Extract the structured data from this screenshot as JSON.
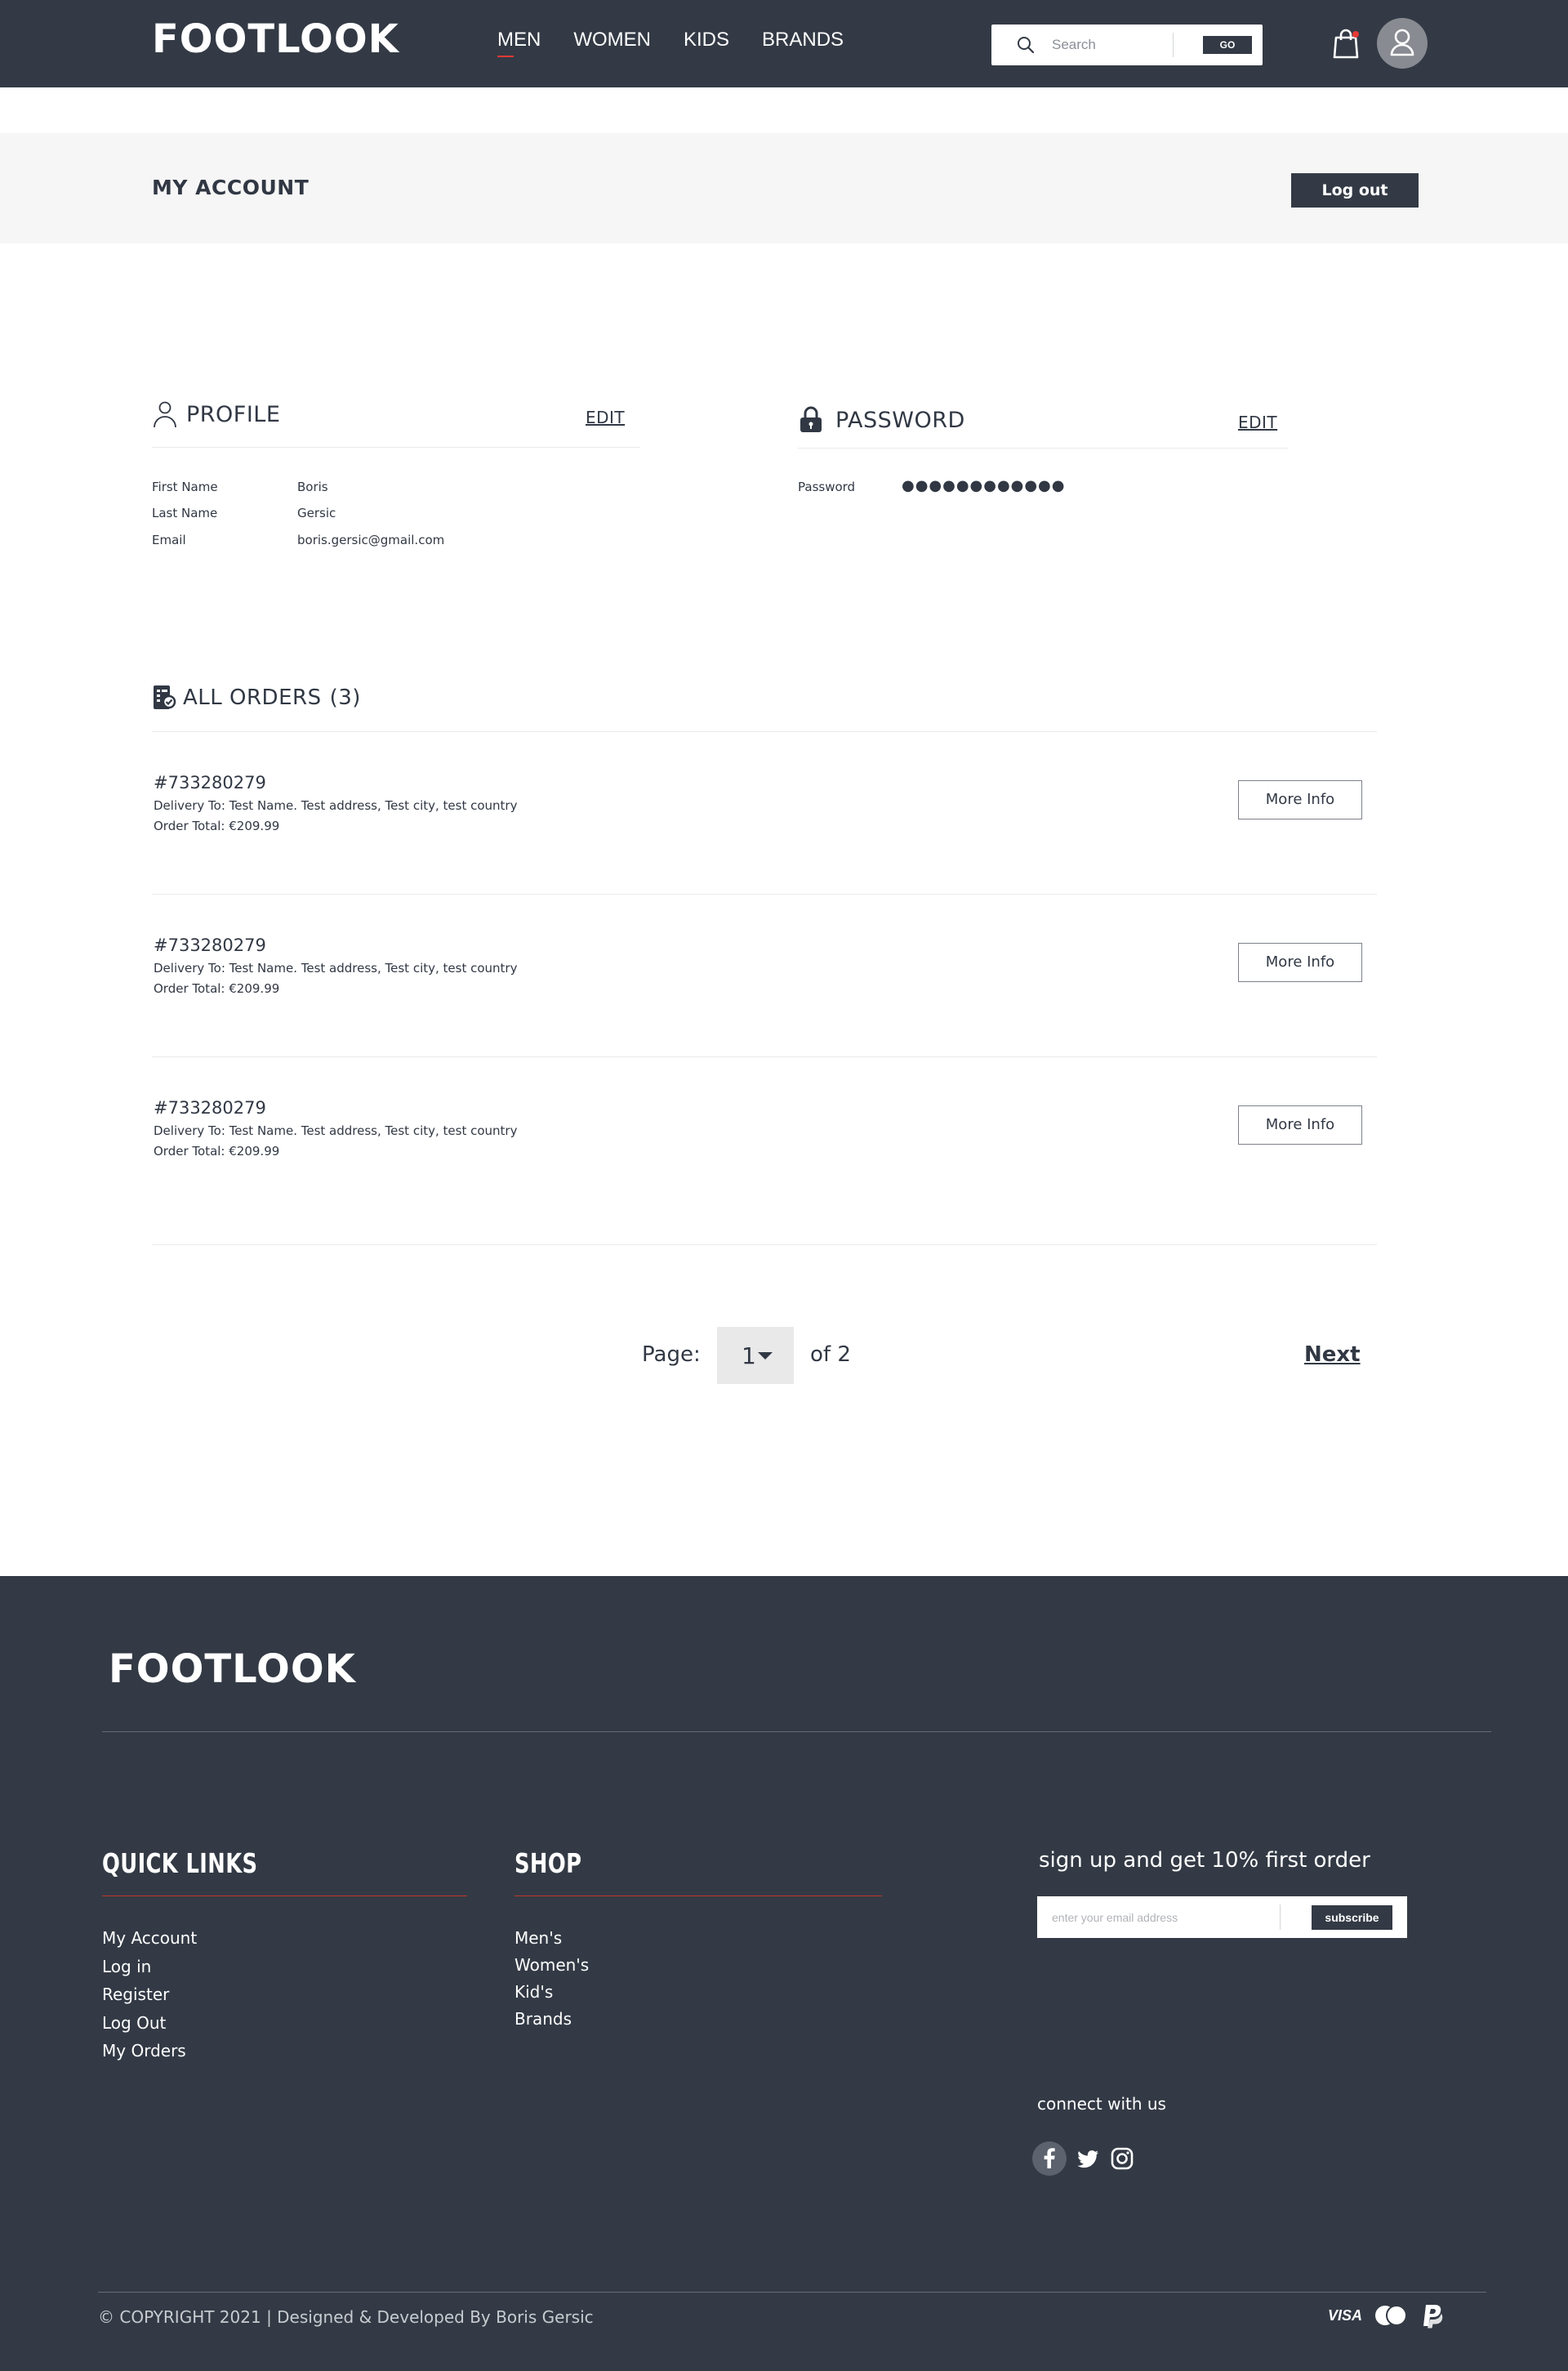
{
  "header": {
    "brand": "FOOTLOOK",
    "nav": [
      "MEN",
      "WOMEN",
      "KIDS",
      "BRANDS"
    ],
    "search_placeholder": "Search",
    "search_button": "GO"
  },
  "account": {
    "title": "MY ACCOUNT",
    "logout_label": "Log out"
  },
  "profile": {
    "title": "PROFILE",
    "edit_label": "EDIT",
    "fields": [
      {
        "label": "First Name",
        "value": "Boris"
      },
      {
        "label": "Last Name",
        "value": "Gersic"
      },
      {
        "label": "Email",
        "value": "boris.gersic@gmail.com"
      }
    ]
  },
  "password": {
    "title": "PASSWORD",
    "edit_label": "EDIT",
    "label": "Password",
    "masked": "●●●●●●●●●●●●"
  },
  "orders": {
    "title": "ALL ORDERS",
    "count": "(3)",
    "more_label": "More Info",
    "items": [
      {
        "id": "#733280279",
        "delivery": "Delivery To: Test Name. Test address, Test city, test country",
        "total": "Order Total: €209.99"
      },
      {
        "id": "#733280279",
        "delivery": "Delivery To: Test Name. Test address, Test city, test country",
        "total": "Order Total: €209.99"
      },
      {
        "id": "#733280279",
        "delivery": "Delivery To: Test Name. Test address, Test city, test country",
        "total": "Order Total: €209.99"
      }
    ]
  },
  "pagination": {
    "label": "Page:",
    "current": "1",
    "of_label": "of 2",
    "next_label": "Next"
  },
  "footer": {
    "brand": "FOOTLOOK",
    "quick_links_title": "QUICK LINKS",
    "quick_links": [
      "My Account",
      "Log in",
      "Register",
      "Log Out",
      "My Orders"
    ],
    "shop_title": "SHOP",
    "shop_links": [
      "Men's",
      "Women's",
      "Kid's",
      "Brands"
    ],
    "signup_title": "sign up and get 10% first order",
    "email_placeholder": "enter your email address",
    "subscribe_label": "subscribe",
    "connect_label": "connect with us",
    "copyright": "© COPYRIGHT 2021 | Designed & Developed By Boris Gersic"
  },
  "colors": {
    "dark": "#333a45",
    "accent": "#e53935",
    "band": "#f6f6f6"
  },
  "icons": [
    "search-icon",
    "shopping-bag-icon",
    "user-icon",
    "lock-icon",
    "orders-icon",
    "facebook-icon",
    "twitter-icon",
    "instagram-icon",
    "visa-icon",
    "mastercard-icon",
    "paypal-icon"
  ]
}
